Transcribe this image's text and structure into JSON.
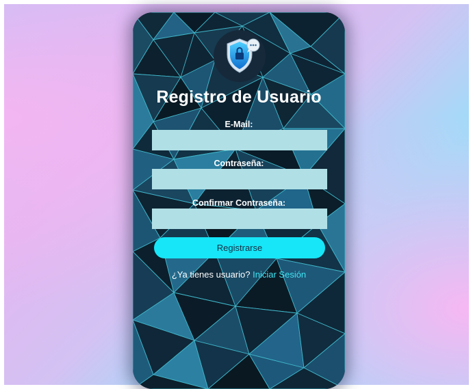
{
  "form": {
    "title": "Registro de Usuario",
    "email_label": "E-Mail:",
    "email_value": "",
    "password_label": "Contraseña:",
    "password_value": "",
    "confirm_label": "Confirmar Contraseña:",
    "confirm_value": "",
    "submit_label": "Registrarse",
    "footer_text": "¿Ya tienes usuario?",
    "login_link": "Iniciar Sesión"
  },
  "colors": {
    "input_bg": "#b0e0e6",
    "button_bg": "#16e6f7",
    "link": "#3fe3f2",
    "card_bg": "#0e2535"
  },
  "icons": {
    "logo": "shield-chat-icon"
  }
}
